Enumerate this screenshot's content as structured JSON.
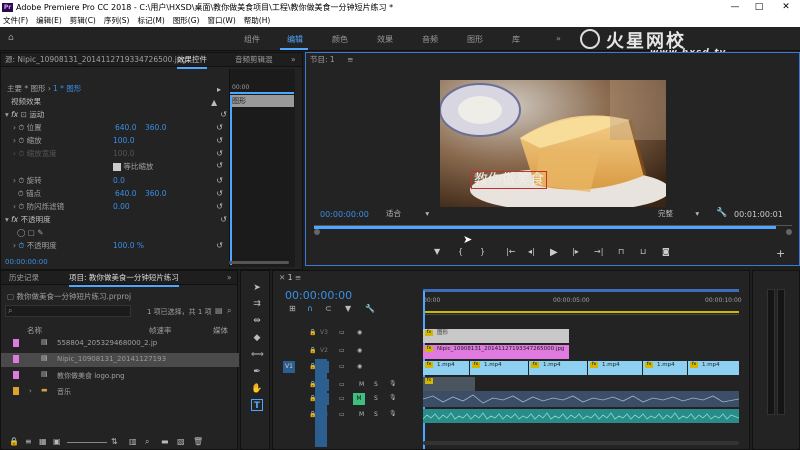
{
  "window": {
    "title": "Adobe Premiere Pro CC 2018 - C:\\用户\\HXSD\\桌面\\教你做美食项目\\工程\\教你做美食一分钟短片练习 *",
    "min": "—",
    "max": "□",
    "close": "✕",
    "app_badge": "Pr"
  },
  "menu": [
    "文件(F)",
    "编辑(E)",
    "剪辑(C)",
    "序列(S)",
    "标记(M)",
    "图形(G)",
    "窗口(W)",
    "帮助(H)"
  ],
  "workspaces": [
    "组件",
    "编辑",
    "颜色",
    "效果",
    "音频",
    "图形",
    "库"
  ],
  "workspace_more": "»",
  "watermark": {
    "brand": "火星网校",
    "url": "www.hxsd.tv"
  },
  "source_panel": {
    "source_label": "源: Nipic_10908131_2014112719334726500.jpg",
    "tab_effect_controls": "效果控件",
    "tab_audio_mixer": "音频剪辑混",
    "master": "主要 * 图形",
    "seq": "1 * 图形",
    "timecode_start": "00:00",
    "clip_label": "图形",
    "video_effects": "视频效果",
    "motion": "运动",
    "position_label": "位置",
    "position_x": "640.0",
    "position_y": "360.0",
    "scale_label": "缩放",
    "scale_val": "100.0",
    "scale_width_label": "缩放宽度",
    "scale_width_val": "100.0",
    "uniform_scale": "等比缩放",
    "rotation_label": "旋转",
    "rotation_val": "0.0",
    "anchor_label": "锚点",
    "anchor_x": "640.0",
    "anchor_y": "360.0",
    "antiflicker_label": "防闪烁滤镜",
    "antiflicker_val": "0.00",
    "opacity_section": "不透明度",
    "opacity_label": "不透明度",
    "opacity_val": "100.0 %",
    "timecode": "00:00:00:00"
  },
  "program": {
    "title": "节目: 1",
    "caption": "教你做美食",
    "timecode": "00:00:00:00",
    "fit": "适合",
    "quality": "完整",
    "duration": "00:01:00:01"
  },
  "project": {
    "tab_history": "历史记录",
    "tab_project": "项目: 教你做美食一分钟短片练习",
    "file": "教你做美食一分钟短片练习.prproj",
    "selection": "1 项已选择，共 1 项",
    "col_name": "名称",
    "col_fps": "帧速率",
    "col_media": "媒体",
    "items": [
      {
        "name": "558804_205329468000_2.jp",
        "color": "#e07ae0"
      },
      {
        "name": "Nipic_10908131_20141127193",
        "color": "#e07ae0"
      },
      {
        "name": "教你做美食 logo.png",
        "color": "#e07ae0"
      },
      {
        "name": "音乐",
        "color": "#e0a030"
      }
    ]
  },
  "timeline": {
    "seq_tab": "1",
    "timecode": "00:00:00:00",
    "ruler": [
      "00:00",
      "00:00:05:00",
      "00:00:10:00"
    ],
    "tracks": {
      "v3": "V3",
      "v2": "V2",
      "v1": "V1",
      "a1": "A1",
      "a2": "A2",
      "a3": "A3",
      "v1_src": "V1",
      "a2_src": "A2"
    },
    "clips": {
      "graphic": "图形",
      "nipic": "Nipic_10908131_20141127193347265000.jpg",
      "mp4": "1.mp4"
    },
    "m": "M",
    "s": "S"
  },
  "colors": {
    "accent": "#4fa6ff",
    "pink_clip": "#e07ae0",
    "graphic_clip": "#c8c8c8",
    "video_clip": "#8ed0ef",
    "audio_clip": "#2a8c8a"
  }
}
